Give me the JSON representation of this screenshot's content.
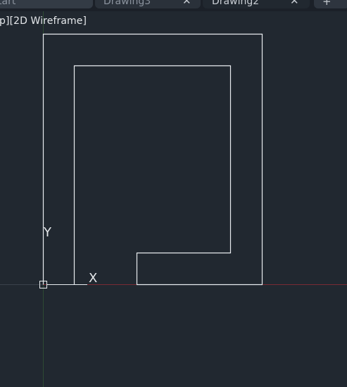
{
  "tabs": {
    "start_label": "tart",
    "drawing3_label": "Drawing3",
    "drawing2_label": "Drawing2",
    "close_glyph": "✕",
    "new_tab_glyph": "+"
  },
  "viewport": {
    "view_control": "p]",
    "visual_style": "[2D Wireframe]"
  },
  "ucs": {
    "y_label": "Y",
    "x_label": "X"
  },
  "colors": {
    "background": "#212830",
    "geometry": "#e8ecef",
    "x_axis": "#7a2b34",
    "y_axis": "#2d4a33",
    "active_tab": "#212830"
  },
  "icons": {
    "close": "close-icon",
    "new_tab": "plus-icon",
    "ucs": "ucs-icon"
  }
}
